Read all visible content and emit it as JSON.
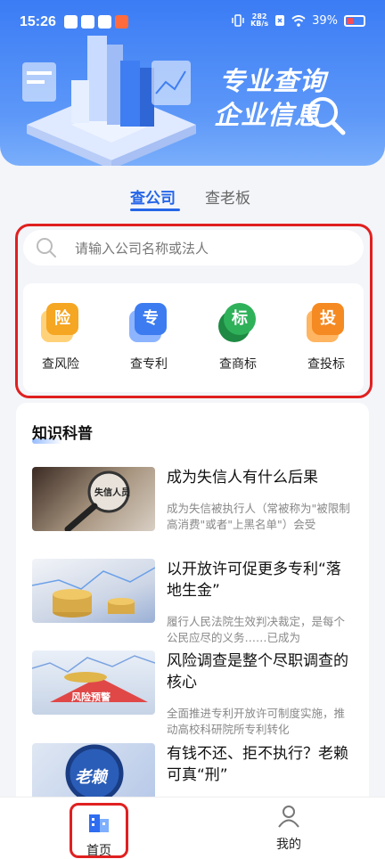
{
  "status_bar": {
    "time": "15:26",
    "net_speed": "282",
    "net_unit": "KB/s",
    "battery": "39%"
  },
  "hero": {
    "slogan_line1": "专业查询",
    "slogan_line2": "企业信",
    "slogan_last_char": "息"
  },
  "tabs": [
    {
      "label": "查公司",
      "active": true
    },
    {
      "label": "查老板",
      "active": false
    }
  ],
  "search": {
    "placeholder": "请输入公司名称或法人"
  },
  "quick_actions": [
    {
      "label": "查风险",
      "glyph": "险",
      "color": "#f5a623"
    },
    {
      "label": "查专利",
      "glyph": "专",
      "color": "#3c7cf0"
    },
    {
      "label": "查商标",
      "glyph": "标",
      "color": "#2fb15a"
    },
    {
      "label": "查投标",
      "glyph": "投",
      "color": "#f58a22"
    }
  ],
  "knowledge": {
    "title": "知识科普",
    "articles": [
      {
        "title": "成为失信人有什么后果",
        "desc": "成为失信被执行人（常被称为\"被限制高消费\"或者\"上黑名单\"）会受",
        "thumb_text": "失信人员"
      },
      {
        "title": "以开放许可促更多专利“落地生金”",
        "desc": "履行人民法院生效判决裁定，是每个公民应尽的义务……已成为",
        "thumb_text": ""
      },
      {
        "title": "风险调查是整个尽职调查的核心",
        "desc": "全面推进专利开放许可制度实施，推动高校科研院所专利转化",
        "thumb_text": "风险预警"
      },
      {
        "title": "有钱不还、拒不执行？老赖可真“刑”",
        "desc": "",
        "thumb_text": "老赖"
      }
    ]
  },
  "bottom_nav": [
    {
      "label": "首页",
      "icon": "building-icon",
      "active": true
    },
    {
      "label": "我的",
      "icon": "person-icon",
      "active": false
    }
  ]
}
